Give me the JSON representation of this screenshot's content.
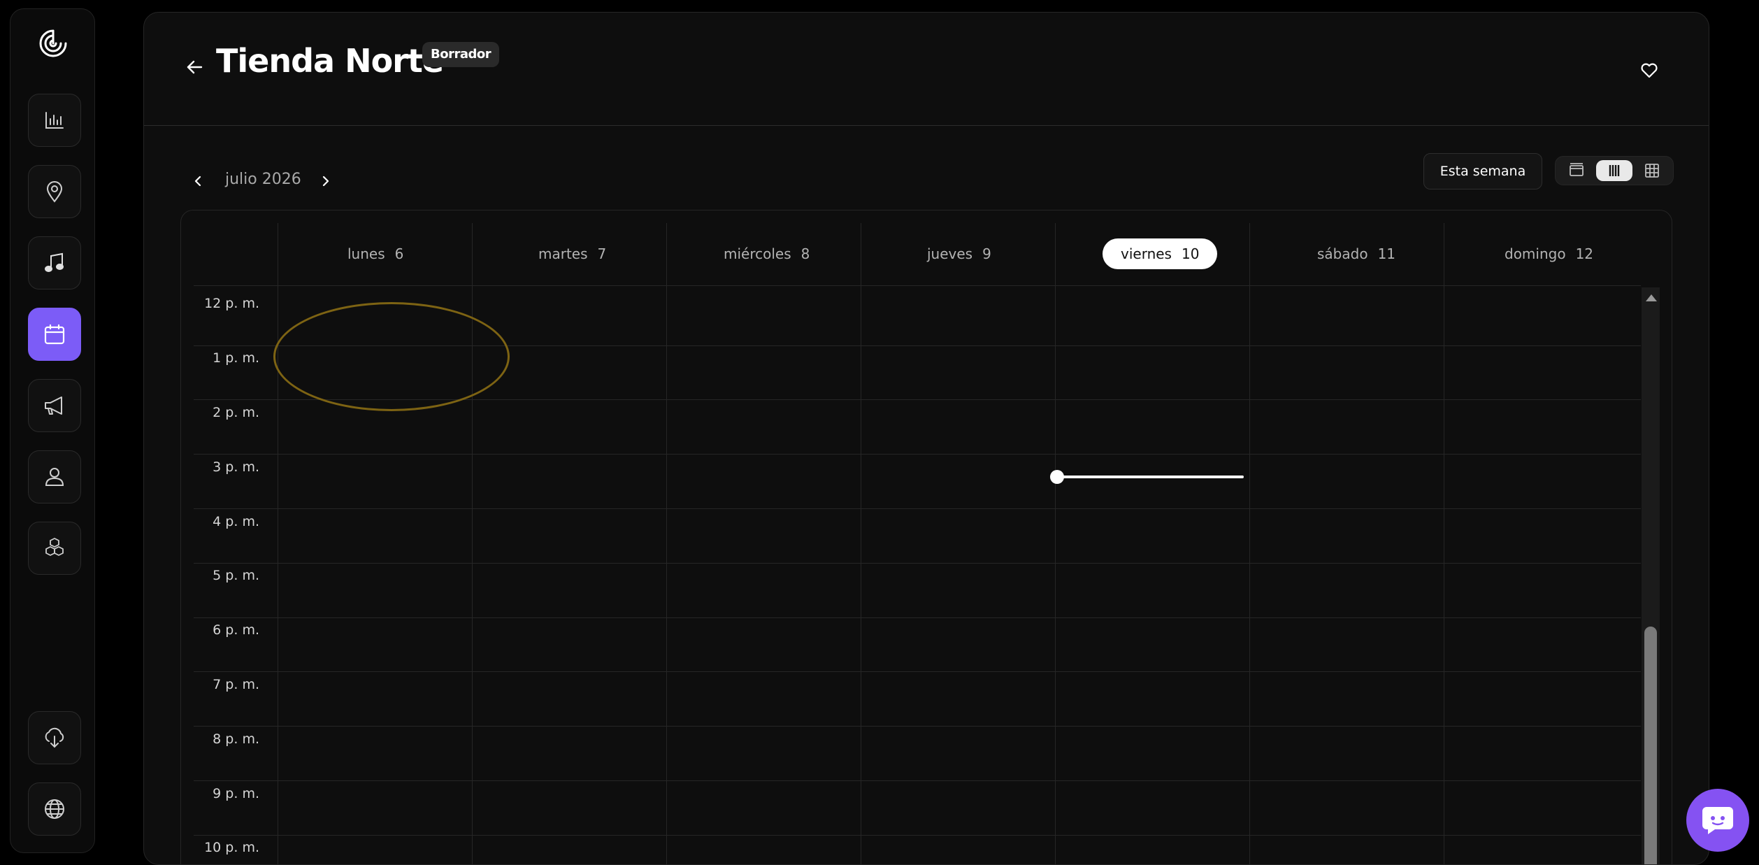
{
  "header": {
    "title": "Tienda Norte",
    "badge": "Borrador"
  },
  "toolbar": {
    "month_label": "julio 2026",
    "this_week_label": "Esta semana",
    "view_modes": [
      "day",
      "week",
      "month"
    ],
    "selected_view": "week"
  },
  "calendar": {
    "days": [
      {
        "name": "lunes",
        "num": "6"
      },
      {
        "name": "martes",
        "num": "7"
      },
      {
        "name": "miércoles",
        "num": "8"
      },
      {
        "name": "jueves",
        "num": "9"
      },
      {
        "name": "viernes",
        "num": "10",
        "today": true
      },
      {
        "name": "sábado",
        "num": "11"
      },
      {
        "name": "domingo",
        "num": "12"
      }
    ],
    "hours": [
      "12 p. m.",
      "1 p. m.",
      "2 p. m.",
      "3 p. m.",
      "4 p. m.",
      "5 p. m.",
      "6 p. m.",
      "7 p. m.",
      "8 p. m.",
      "9 p. m.",
      "10 p. m."
    ]
  },
  "sidebar": {
    "items": [
      {
        "icon": "analytics-icon"
      },
      {
        "icon": "location-pin-icon"
      },
      {
        "icon": "music-note-icon"
      },
      {
        "icon": "calendar-icon",
        "active": true
      },
      {
        "icon": "megaphone-icon"
      },
      {
        "icon": "user-icon"
      },
      {
        "icon": "cubes-icon"
      }
    ],
    "bottom_items": [
      {
        "icon": "cloud-download-icon"
      },
      {
        "icon": "globe-icon"
      }
    ]
  },
  "colors": {
    "accent": "#7c5cf7",
    "chat": "#8552f2",
    "highlight": "#7d6313"
  }
}
